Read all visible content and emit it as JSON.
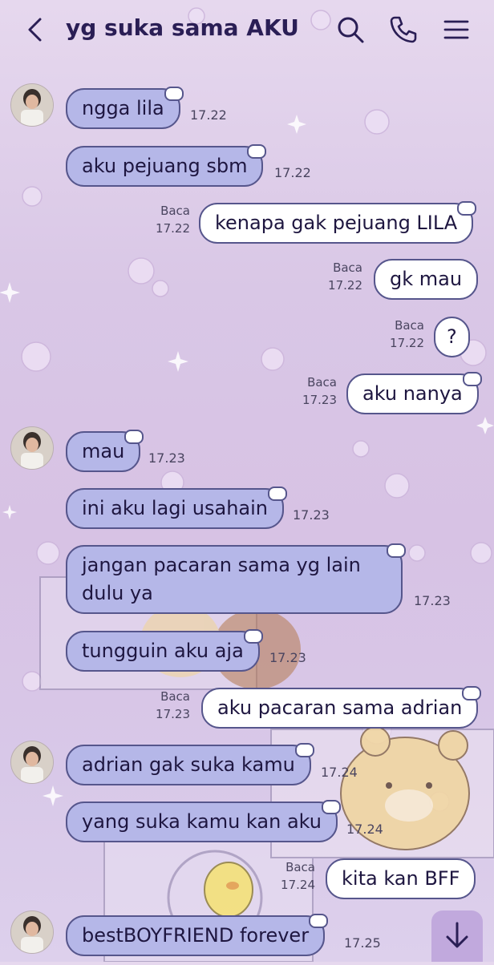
{
  "header": {
    "title": "yg suka sama AKU",
    "icons": [
      "back-icon",
      "search-icon",
      "call-icon",
      "menu-icon"
    ]
  },
  "messages": [
    {
      "side": "in",
      "avatar": true,
      "text": "ngga lila",
      "time": "17.22"
    },
    {
      "side": "in",
      "avatar": false,
      "text": "aku pejuang sbm",
      "time": "17.22"
    },
    {
      "side": "out",
      "status": "Baca",
      "text": "kenapa gak pejuang LILA",
      "time": "17.22"
    },
    {
      "side": "out",
      "status": "Baca",
      "text": "gk mau",
      "time": "17.22"
    },
    {
      "side": "out",
      "status": "Baca",
      "text": "?",
      "time": "17.22"
    },
    {
      "side": "out",
      "status": "Baca",
      "text": "aku nanya",
      "time": "17.23"
    },
    {
      "side": "in",
      "avatar": true,
      "text": "mau",
      "time": "17.23"
    },
    {
      "side": "in",
      "avatar": false,
      "text": "ini aku lagi usahain",
      "time": "17.23"
    },
    {
      "side": "in",
      "avatar": false,
      "text": "jangan pacaran sama yg lain dulu ya",
      "time": "17.23"
    },
    {
      "side": "in",
      "avatar": false,
      "text": "tungguin aku aja",
      "time": "17.23"
    },
    {
      "side": "out",
      "status": "Baca",
      "text": "aku pacaran sama adrian",
      "time": "17.23"
    },
    {
      "side": "in",
      "avatar": true,
      "text": "adrian gak suka kamu",
      "time": "17.24"
    },
    {
      "side": "in",
      "avatar": false,
      "text": "yang suka kamu kan aku",
      "time": "17.24"
    },
    {
      "side": "out",
      "status": "Baca",
      "text": "kita kan BFF",
      "time": "17.24"
    },
    {
      "side": "in",
      "avatar": true,
      "text": "bestBOYFRIEND forever",
      "time": "17.25"
    }
  ],
  "jangan_line1": "jangan pacaran sama yg lain",
  "jangan_line2": "dulu ya",
  "colors": {
    "incoming_bubble": "#b5b7e8",
    "outgoing_bubble": "#ffffff",
    "bubble_border": "#56568c",
    "title": "#2a1e55"
  }
}
